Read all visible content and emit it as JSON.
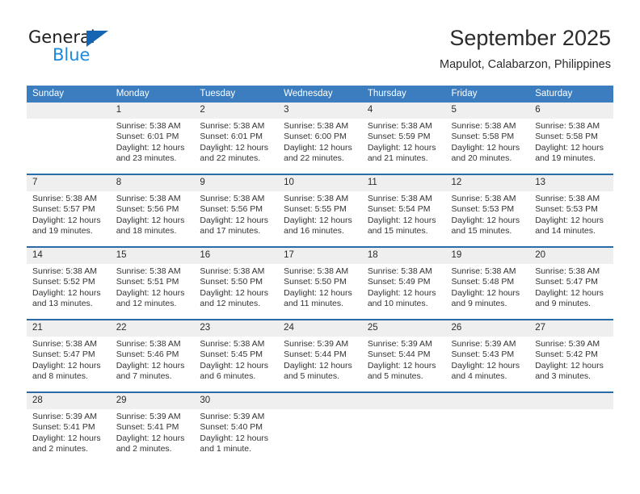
{
  "logo": {
    "text_top": "General",
    "text_bottom": "Blue",
    "triangle_color": "#1665b3",
    "blue_color": "#1b8ae0",
    "icon": "triangle-icon"
  },
  "header": {
    "title": "September 2025",
    "subtitle": "Mapulot, Calabarzon, Philippines"
  },
  "theme": {
    "header_bg": "#3b7dbf",
    "row_divider": "#2a6ba8",
    "daynum_bg": "#efefef",
    "text": "#333333"
  },
  "weekdays": [
    "Sunday",
    "Monday",
    "Tuesday",
    "Wednesday",
    "Thursday",
    "Friday",
    "Saturday"
  ],
  "weeks": [
    [
      {
        "day": "",
        "sunrise": "",
        "sunset": "",
        "daylight1": "",
        "daylight2": ""
      },
      {
        "day": "1",
        "sunrise": "Sunrise: 5:38 AM",
        "sunset": "Sunset: 6:01 PM",
        "daylight1": "Daylight: 12 hours",
        "daylight2": "and 23 minutes."
      },
      {
        "day": "2",
        "sunrise": "Sunrise: 5:38 AM",
        "sunset": "Sunset: 6:01 PM",
        "daylight1": "Daylight: 12 hours",
        "daylight2": "and 22 minutes."
      },
      {
        "day": "3",
        "sunrise": "Sunrise: 5:38 AM",
        "sunset": "Sunset: 6:00 PM",
        "daylight1": "Daylight: 12 hours",
        "daylight2": "and 22 minutes."
      },
      {
        "day": "4",
        "sunrise": "Sunrise: 5:38 AM",
        "sunset": "Sunset: 5:59 PM",
        "daylight1": "Daylight: 12 hours",
        "daylight2": "and 21 minutes."
      },
      {
        "day": "5",
        "sunrise": "Sunrise: 5:38 AM",
        "sunset": "Sunset: 5:58 PM",
        "daylight1": "Daylight: 12 hours",
        "daylight2": "and 20 minutes."
      },
      {
        "day": "6",
        "sunrise": "Sunrise: 5:38 AM",
        "sunset": "Sunset: 5:58 PM",
        "daylight1": "Daylight: 12 hours",
        "daylight2": "and 19 minutes."
      }
    ],
    [
      {
        "day": "7",
        "sunrise": "Sunrise: 5:38 AM",
        "sunset": "Sunset: 5:57 PM",
        "daylight1": "Daylight: 12 hours",
        "daylight2": "and 19 minutes."
      },
      {
        "day": "8",
        "sunrise": "Sunrise: 5:38 AM",
        "sunset": "Sunset: 5:56 PM",
        "daylight1": "Daylight: 12 hours",
        "daylight2": "and 18 minutes."
      },
      {
        "day": "9",
        "sunrise": "Sunrise: 5:38 AM",
        "sunset": "Sunset: 5:56 PM",
        "daylight1": "Daylight: 12 hours",
        "daylight2": "and 17 minutes."
      },
      {
        "day": "10",
        "sunrise": "Sunrise: 5:38 AM",
        "sunset": "Sunset: 5:55 PM",
        "daylight1": "Daylight: 12 hours",
        "daylight2": "and 16 minutes."
      },
      {
        "day": "11",
        "sunrise": "Sunrise: 5:38 AM",
        "sunset": "Sunset: 5:54 PM",
        "daylight1": "Daylight: 12 hours",
        "daylight2": "and 15 minutes."
      },
      {
        "day": "12",
        "sunrise": "Sunrise: 5:38 AM",
        "sunset": "Sunset: 5:53 PM",
        "daylight1": "Daylight: 12 hours",
        "daylight2": "and 15 minutes."
      },
      {
        "day": "13",
        "sunrise": "Sunrise: 5:38 AM",
        "sunset": "Sunset: 5:53 PM",
        "daylight1": "Daylight: 12 hours",
        "daylight2": "and 14 minutes."
      }
    ],
    [
      {
        "day": "14",
        "sunrise": "Sunrise: 5:38 AM",
        "sunset": "Sunset: 5:52 PM",
        "daylight1": "Daylight: 12 hours",
        "daylight2": "and 13 minutes."
      },
      {
        "day": "15",
        "sunrise": "Sunrise: 5:38 AM",
        "sunset": "Sunset: 5:51 PM",
        "daylight1": "Daylight: 12 hours",
        "daylight2": "and 12 minutes."
      },
      {
        "day": "16",
        "sunrise": "Sunrise: 5:38 AM",
        "sunset": "Sunset: 5:50 PM",
        "daylight1": "Daylight: 12 hours",
        "daylight2": "and 12 minutes."
      },
      {
        "day": "17",
        "sunrise": "Sunrise: 5:38 AM",
        "sunset": "Sunset: 5:50 PM",
        "daylight1": "Daylight: 12 hours",
        "daylight2": "and 11 minutes."
      },
      {
        "day": "18",
        "sunrise": "Sunrise: 5:38 AM",
        "sunset": "Sunset: 5:49 PM",
        "daylight1": "Daylight: 12 hours",
        "daylight2": "and 10 minutes."
      },
      {
        "day": "19",
        "sunrise": "Sunrise: 5:38 AM",
        "sunset": "Sunset: 5:48 PM",
        "daylight1": "Daylight: 12 hours",
        "daylight2": "and 9 minutes."
      },
      {
        "day": "20",
        "sunrise": "Sunrise: 5:38 AM",
        "sunset": "Sunset: 5:47 PM",
        "daylight1": "Daylight: 12 hours",
        "daylight2": "and 9 minutes."
      }
    ],
    [
      {
        "day": "21",
        "sunrise": "Sunrise: 5:38 AM",
        "sunset": "Sunset: 5:47 PM",
        "daylight1": "Daylight: 12 hours",
        "daylight2": "and 8 minutes."
      },
      {
        "day": "22",
        "sunrise": "Sunrise: 5:38 AM",
        "sunset": "Sunset: 5:46 PM",
        "daylight1": "Daylight: 12 hours",
        "daylight2": "and 7 minutes."
      },
      {
        "day": "23",
        "sunrise": "Sunrise: 5:38 AM",
        "sunset": "Sunset: 5:45 PM",
        "daylight1": "Daylight: 12 hours",
        "daylight2": "and 6 minutes."
      },
      {
        "day": "24",
        "sunrise": "Sunrise: 5:39 AM",
        "sunset": "Sunset: 5:44 PM",
        "daylight1": "Daylight: 12 hours",
        "daylight2": "and 5 minutes."
      },
      {
        "day": "25",
        "sunrise": "Sunrise: 5:39 AM",
        "sunset": "Sunset: 5:44 PM",
        "daylight1": "Daylight: 12 hours",
        "daylight2": "and 5 minutes."
      },
      {
        "day": "26",
        "sunrise": "Sunrise: 5:39 AM",
        "sunset": "Sunset: 5:43 PM",
        "daylight1": "Daylight: 12 hours",
        "daylight2": "and 4 minutes."
      },
      {
        "day": "27",
        "sunrise": "Sunrise: 5:39 AM",
        "sunset": "Sunset: 5:42 PM",
        "daylight1": "Daylight: 12 hours",
        "daylight2": "and 3 minutes."
      }
    ],
    [
      {
        "day": "28",
        "sunrise": "Sunrise: 5:39 AM",
        "sunset": "Sunset: 5:41 PM",
        "daylight1": "Daylight: 12 hours",
        "daylight2": "and 2 minutes."
      },
      {
        "day": "29",
        "sunrise": "Sunrise: 5:39 AM",
        "sunset": "Sunset: 5:41 PM",
        "daylight1": "Daylight: 12 hours",
        "daylight2": "and 2 minutes."
      },
      {
        "day": "30",
        "sunrise": "Sunrise: 5:39 AM",
        "sunset": "Sunset: 5:40 PM",
        "daylight1": "Daylight: 12 hours",
        "daylight2": "and 1 minute."
      },
      {
        "day": "",
        "sunrise": "",
        "sunset": "",
        "daylight1": "",
        "daylight2": ""
      },
      {
        "day": "",
        "sunrise": "",
        "sunset": "",
        "daylight1": "",
        "daylight2": ""
      },
      {
        "day": "",
        "sunrise": "",
        "sunset": "",
        "daylight1": "",
        "daylight2": ""
      },
      {
        "day": "",
        "sunrise": "",
        "sunset": "",
        "daylight1": "",
        "daylight2": ""
      }
    ]
  ]
}
